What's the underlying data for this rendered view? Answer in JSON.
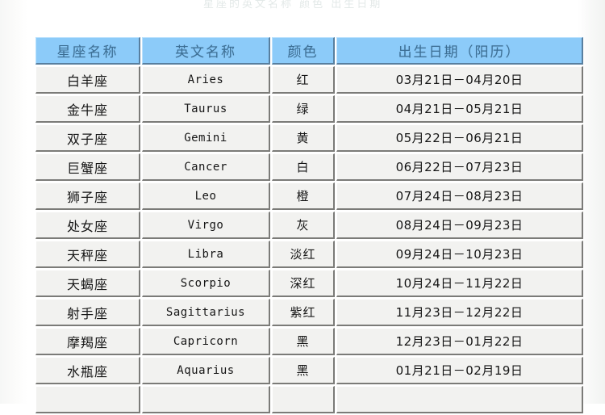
{
  "document": {
    "clipped_top_text": "星座的英文名称 颜色 出生日期"
  },
  "table": {
    "columns": [
      {
        "key": "name",
        "label": "星座名称"
      },
      {
        "key": "en",
        "label": "英文名称"
      },
      {
        "key": "color",
        "label": "颜色"
      },
      {
        "key": "date",
        "label": "出生日期（阳历）"
      }
    ],
    "rows": [
      {
        "name": "白羊座",
        "en": "Aries",
        "color": "红",
        "date": "03月21日－04月20日"
      },
      {
        "name": "金牛座",
        "en": "Taurus",
        "color": "绿",
        "date": "04月21日－05月21日"
      },
      {
        "name": "双子座",
        "en": "Gemini",
        "color": "黄",
        "date": "05月22日－06月21日"
      },
      {
        "name": "巨蟹座",
        "en": "Cancer",
        "color": "白",
        "date": "06月22日－07月23日"
      },
      {
        "name": "狮子座",
        "en": "Leo",
        "color": "橙",
        "date": "07月24日－08月23日"
      },
      {
        "name": "处女座",
        "en": "Virgo",
        "color": "灰",
        "date": "08月24日－09月23日"
      },
      {
        "name": "天秤座",
        "en": "Libra",
        "color": "淡红",
        "date": "09月24日－10月23日"
      },
      {
        "name": "天蝎座",
        "en": "Scorpio",
        "color": "深红",
        "date": "10月24日－11月22日"
      },
      {
        "name": "射手座",
        "en": "Sagittarius",
        "color": "紫红",
        "date": "11月23日－12月22日"
      },
      {
        "name": "摩羯座",
        "en": "Capricorn",
        "color": "黑",
        "date": "12月23日－01月22日"
      },
      {
        "name": "水瓶座",
        "en": "Aquarius",
        "color": "黑",
        "date": "01月21日－02月19日"
      },
      {
        "name": "",
        "en": "",
        "color": "",
        "date": ""
      }
    ]
  },
  "colors": {
    "header_bg": "#8cc8f4",
    "header_text": "#3f6f93",
    "cell_bg": "#eeeeec",
    "cell_text": "#1a1a1a",
    "cell_border_dark": "#7b7b78",
    "page_bg": "#ffffff"
  }
}
